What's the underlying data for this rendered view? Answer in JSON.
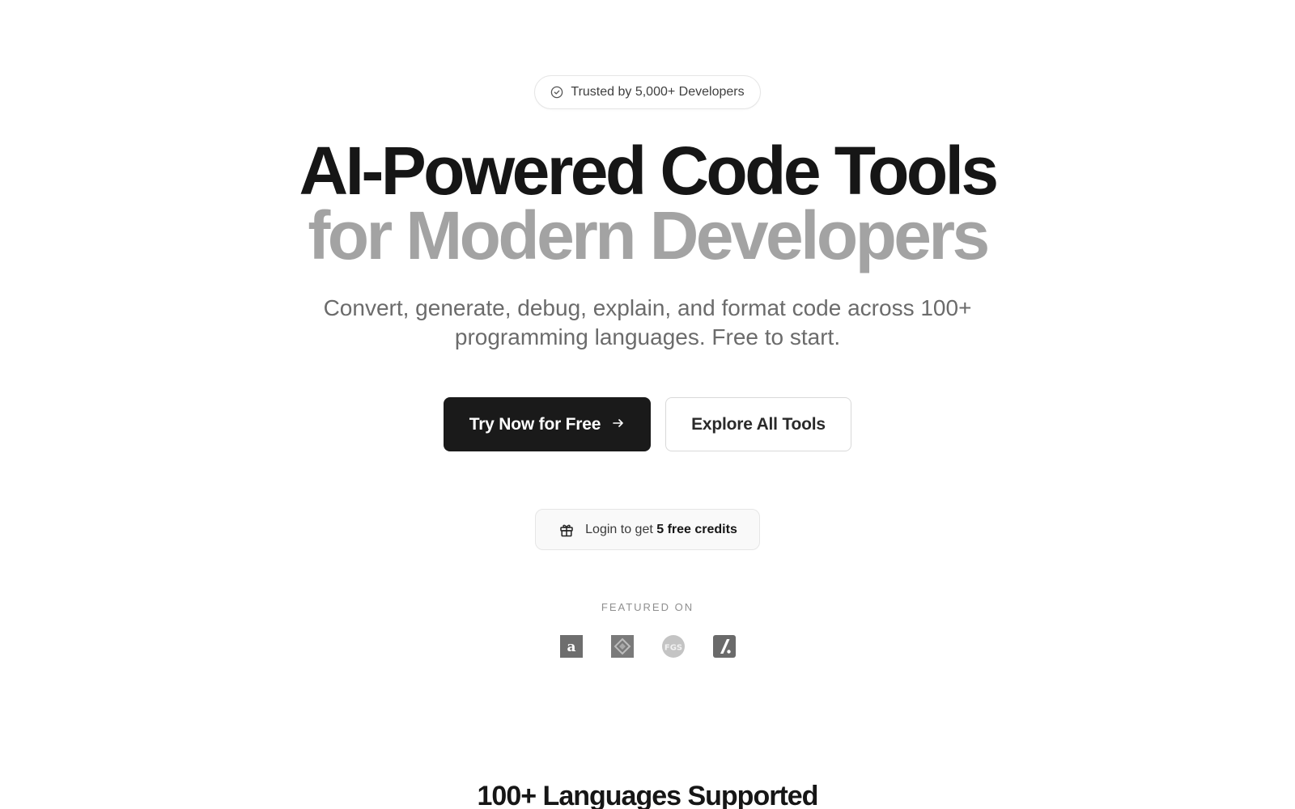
{
  "trust_badge": {
    "icon": "check-circle-icon",
    "text": "Trusted by 5,000+ Developers"
  },
  "headline": {
    "line1": "AI-Powered Code Tools",
    "line2": "for Modern Developers"
  },
  "subtitle": "Convert, generate, debug, explain, and format code across 100+ programming languages. Free to start.",
  "cta": {
    "primary_label": "Try Now for Free",
    "primary_icon": "arrow-right-icon",
    "secondary_label": "Explore All Tools"
  },
  "credits": {
    "icon": "gift-icon",
    "prefix": "Login to get",
    "highlight": "5 free credits"
  },
  "featured": {
    "label": "FEATURED ON",
    "logos": [
      "featured-logo-a-icon",
      "featured-logo-diamond-icon",
      "featured-logo-fgs-icon",
      "featured-logo-slash-icon"
    ]
  },
  "languages_section": {
    "title": "100+ Languages Supported"
  },
  "colors": {
    "primary_text": "#161616",
    "muted_headline": "#a3a3a3",
    "primary_button_bg": "#1a1a1a",
    "logo_gray": "#6f6f6f"
  }
}
